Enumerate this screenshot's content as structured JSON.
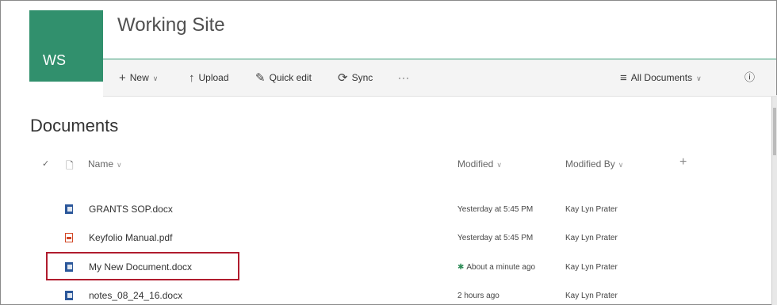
{
  "site": {
    "logo_text": "WS",
    "title": "Working Site"
  },
  "commandbar": {
    "new_label": "New",
    "upload_label": "Upload",
    "quickedit_label": "Quick edit",
    "sync_label": "Sync",
    "more_label": "···",
    "view_label": "All Documents",
    "info_icon": "ⓘ"
  },
  "library": {
    "title": "Documents"
  },
  "columns": {
    "name": "Name",
    "modified": "Modified",
    "modified_by": "Modified By",
    "add": "+"
  },
  "rows": [
    {
      "name": "GRANTS SOP.docx",
      "modified": "Yesterday at 5:45 PM",
      "modified_by": "Kay Lyn Prater",
      "type": "word",
      "new": false
    },
    {
      "name": "Keyfolio Manual.pdf",
      "modified": "Yesterday at 5:45 PM",
      "modified_by": "Kay Lyn Prater",
      "type": "pdf",
      "new": false
    },
    {
      "name": "My New Document.docx",
      "modified": "About a minute ago",
      "modified_by": "Kay Lyn Prater",
      "type": "word",
      "new": true
    },
    {
      "name": "notes_08_24_16.docx",
      "modified": "2 hours ago",
      "modified_by": "Kay Lyn Prater",
      "type": "word",
      "new": false
    }
  ],
  "colors": {
    "brand": "#31906d",
    "highlight": "#b01c2e",
    "new_indicator": "#2e8b57"
  }
}
